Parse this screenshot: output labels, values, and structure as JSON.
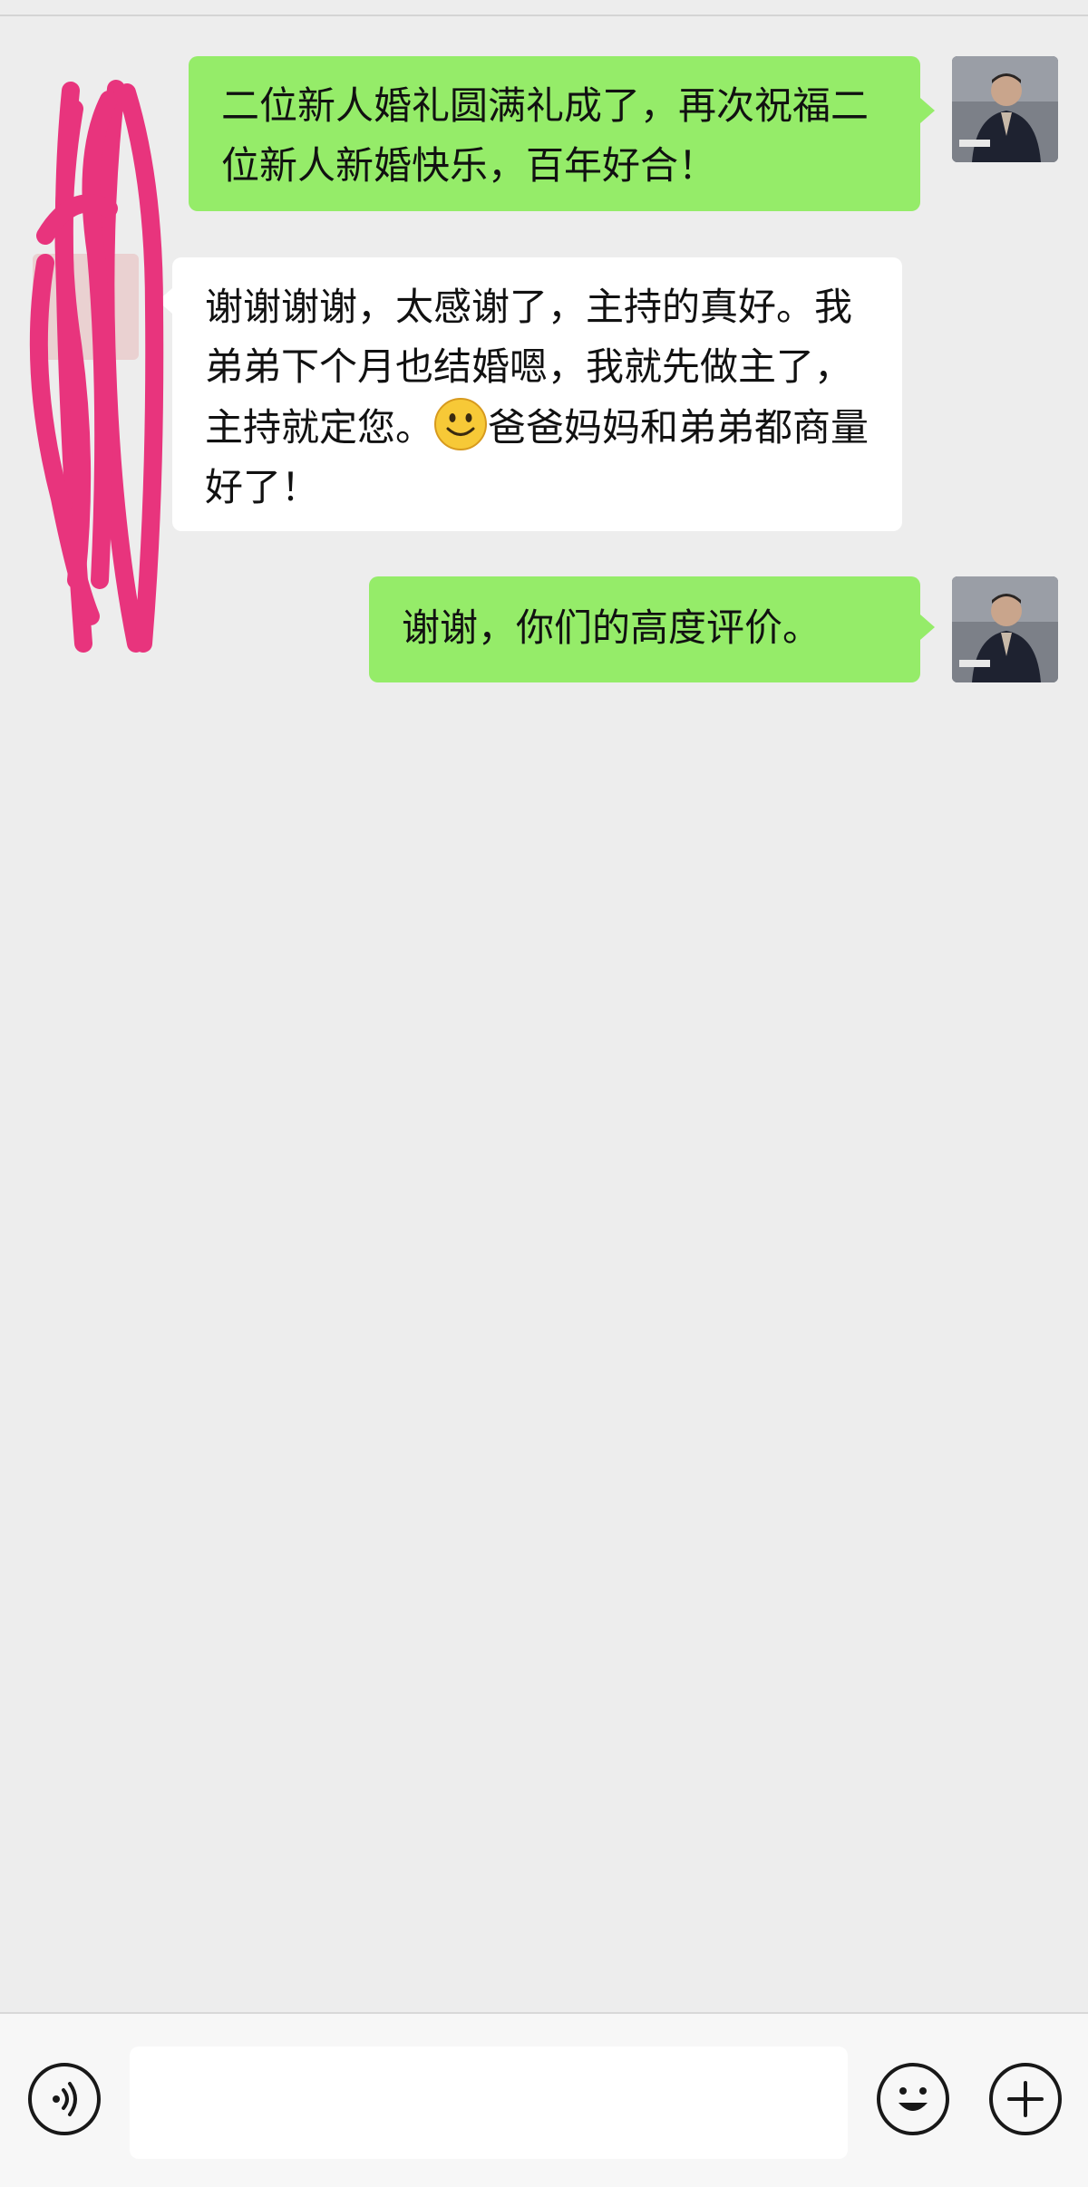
{
  "messages": [
    {
      "side": "right",
      "text": "二位新人婚礼圆满礼成了，再次祝福二位新人新婚快乐，百年好合！"
    },
    {
      "side": "left",
      "text_before_emoji": "谢谢谢谢，太感谢了，主持的真好。我弟弟下个月也结婚嗯，我就先做主了，主持就定您。",
      "emoji": "smile-emoji",
      "text_after_emoji": "爸爸妈妈和弟弟都商量好了！"
    },
    {
      "side": "right",
      "text": "谢谢，你们的高度评价。"
    }
  ],
  "input": {
    "value": "",
    "placeholder": ""
  },
  "icons": {
    "voice": "voice-icon",
    "emoji": "emoji-icon",
    "more": "plus-icon"
  },
  "colors": {
    "background": "#ededed",
    "sent_bubble": "#95ec69",
    "received_bubble": "#ffffff",
    "scribble": "#e8347d"
  }
}
